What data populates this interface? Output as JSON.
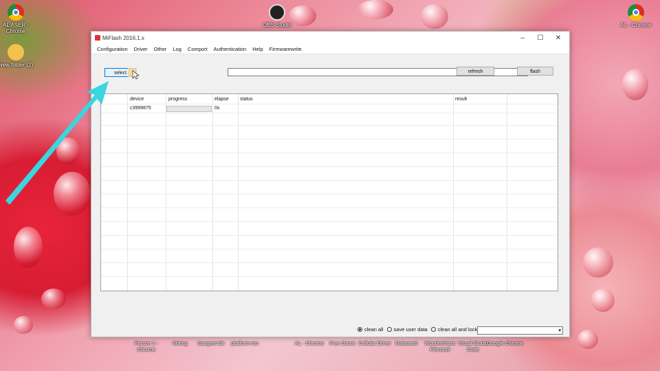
{
  "window": {
    "title": "MiFlash 2016.1.x",
    "controls": {
      "minimize": "–",
      "maximize": "☐",
      "close": "✕"
    }
  },
  "menu": [
    "Configuration",
    "Driver",
    "Other",
    "Log",
    "Comport",
    "Authentication",
    "Help",
    "Firmwarewrite"
  ],
  "toolbar": {
    "select_label": "select",
    "path_value": "",
    "refresh_label": "refresh",
    "flash_label": "flash"
  },
  "table": {
    "headers": {
      "num": "",
      "device": "device",
      "progress": "progress",
      "elapse": "elapse",
      "status": "status",
      "result": "result"
    },
    "rows": [
      {
        "device": "c3999875",
        "progress": 0,
        "elapse": "0s",
        "status": "",
        "result": ""
      }
    ]
  },
  "options": {
    "clean_all": "clean all",
    "save_user_data": "save user data",
    "clean_all_and_lock": "clean all and lock",
    "selected": "clean all",
    "combo_value": ""
  },
  "desktop": {
    "icons_left": [
      {
        "label": "AL ASER - Chrome",
        "icon": "chrome-icon"
      },
      {
        "label": "New folder (2)",
        "icon": "folder-icon"
      }
    ],
    "icon_top_center": {
      "label": "OBS Studio",
      "icon": "obs-icon"
    },
    "icon_top_right": {
      "label": "AL - Chrome",
      "icon": "chrome-icon"
    },
    "taskbar_labels": [
      "Person 1 - Chrome",
      "Mixing",
      "Sangeet Dir",
      "platform-too",
      "AL - Chrome",
      "Free Game",
      "Cellular Driver",
      "Malwareb",
      "Wondershare Filmora9",
      "Visual Studio Code",
      "Google Chrome"
    ]
  },
  "colors": {
    "accent": "#0078d7",
    "arrow": "#39d6e0",
    "progress": "#06b025"
  }
}
